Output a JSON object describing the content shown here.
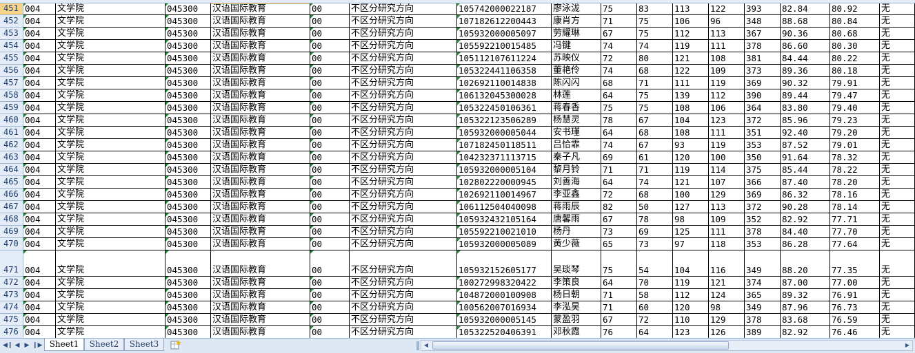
{
  "sheet": {
    "rows": [
      {
        "num": "451",
        "dept_code": "004",
        "dept": "文学院",
        "major_code": "045300",
        "major": "汉语国际教育",
        "dir_code": "00",
        "dir": "不区分研究方向",
        "exam_no": "105742000022187",
        "name": "廖泳泷",
        "s1": "75",
        "s2": "83",
        "s3": "113",
        "s4": "122",
        "total": "393",
        "retest": "82.84",
        "final": "80.92",
        "remark": "无"
      },
      {
        "num": "452",
        "dept_code": "004",
        "dept": "文学院",
        "major_code": "045300",
        "major": "汉语国际教育",
        "dir_code": "00",
        "dir": "不区分研究方向",
        "exam_no": "107182612200443",
        "name": "康肖方",
        "s1": "71",
        "s2": "75",
        "s3": "106",
        "s4": "96",
        "total": "348",
        "retest": "88.68",
        "final": "80.84",
        "remark": "无"
      },
      {
        "num": "453",
        "dept_code": "004",
        "dept": "文学院",
        "major_code": "045300",
        "major": "汉语国际教育",
        "dir_code": "00",
        "dir": "不区分研究方向",
        "exam_no": "105932000005097",
        "name": "劳耀琳",
        "s1": "67",
        "s2": "75",
        "s3": "112",
        "s4": "113",
        "total": "367",
        "retest": "90.36",
        "final": "80.68",
        "remark": "无"
      },
      {
        "num": "454",
        "dept_code": "004",
        "dept": "文学院",
        "major_code": "045300",
        "major": "汉语国际教育",
        "dir_code": "00",
        "dir": "不区分研究方向",
        "exam_no": "105592210015485",
        "name": "冯键",
        "s1": "74",
        "s2": "74",
        "s3": "119",
        "s4": "111",
        "total": "378",
        "retest": "86.60",
        "final": "80.30",
        "remark": "无"
      },
      {
        "num": "455",
        "dept_code": "004",
        "dept": "文学院",
        "major_code": "045300",
        "major": "汉语国际教育",
        "dir_code": "00",
        "dir": "不区分研究方向",
        "exam_no": "105112107611224",
        "name": "苏映仪",
        "s1": "72",
        "s2": "80",
        "s3": "121",
        "s4": "108",
        "total": "381",
        "retest": "84.44",
        "final": "80.22",
        "remark": "无"
      },
      {
        "num": "456",
        "dept_code": "004",
        "dept": "文学院",
        "major_code": "045300",
        "major": "汉语国际教育",
        "dir_code": "00",
        "dir": "不区分研究方向",
        "exam_no": "105322441106358",
        "name": "董艳伶",
        "s1": "74",
        "s2": "68",
        "s3": "122",
        "s4": "109",
        "total": "373",
        "retest": "89.36",
        "final": "80.18",
        "remark": "无"
      },
      {
        "num": "457",
        "dept_code": "004",
        "dept": "文学院",
        "major_code": "045300",
        "major": "汉语国际教育",
        "dir_code": "00",
        "dir": "不区分研究方向",
        "exam_no": "102692110014838",
        "name": "陈闪闪",
        "s1": "68",
        "s2": "71",
        "s3": "111",
        "s4": "119",
        "total": "369",
        "retest": "90.32",
        "final": "79.91",
        "remark": "无"
      },
      {
        "num": "458",
        "dept_code": "004",
        "dept": "文学院",
        "major_code": "045300",
        "major": "汉语国际教育",
        "dir_code": "00",
        "dir": "不区分研究方向",
        "exam_no": "106132045300028",
        "name": "林莲",
        "s1": "64",
        "s2": "75",
        "s3": "139",
        "s4": "112",
        "total": "390",
        "retest": "89.44",
        "final": "79.47",
        "remark": "无"
      },
      {
        "num": "459",
        "dept_code": "004",
        "dept": "文学院",
        "major_code": "045300",
        "major": "汉语国际教育",
        "dir_code": "00",
        "dir": "不区分研究方向",
        "exam_no": "105322450106361",
        "name": "蒋春香",
        "s1": "75",
        "s2": "75",
        "s3": "108",
        "s4": "106",
        "total": "364",
        "retest": "83.80",
        "final": "79.40",
        "remark": "无"
      },
      {
        "num": "460",
        "dept_code": "004",
        "dept": "文学院",
        "major_code": "045300",
        "major": "汉语国际教育",
        "dir_code": "00",
        "dir": "不区分研究方向",
        "exam_no": "105322123506289",
        "name": "杨慧灵",
        "s1": "78",
        "s2": "67",
        "s3": "104",
        "s4": "123",
        "total": "372",
        "retest": "85.96",
        "final": "79.23",
        "remark": "无"
      },
      {
        "num": "461",
        "dept_code": "004",
        "dept": "文学院",
        "major_code": "045300",
        "major": "汉语国际教育",
        "dir_code": "00",
        "dir": "不区分研究方向",
        "exam_no": "105932000005044",
        "name": "安书瑾",
        "s1": "64",
        "s2": "68",
        "s3": "108",
        "s4": "111",
        "total": "351",
        "retest": "92.40",
        "final": "79.20",
        "remark": "无"
      },
      {
        "num": "462",
        "dept_code": "004",
        "dept": "文学院",
        "major_code": "045300",
        "major": "汉语国际教育",
        "dir_code": "00",
        "dir": "不区分研究方向",
        "exam_no": "107182450118511",
        "name": "吕恰霏",
        "s1": "74",
        "s2": "67",
        "s3": "93",
        "s4": "119",
        "total": "353",
        "retest": "87.52",
        "final": "79.01",
        "remark": "无"
      },
      {
        "num": "463",
        "dept_code": "004",
        "dept": "文学院",
        "major_code": "045300",
        "major": "汉语国际教育",
        "dir_code": "00",
        "dir": "不区分研究方向",
        "exam_no": "104232371113715",
        "name": "秦子凡",
        "s1": "69",
        "s2": "61",
        "s3": "120",
        "s4": "100",
        "total": "350",
        "retest": "91.64",
        "final": "78.32",
        "remark": "无"
      },
      {
        "num": "464",
        "dept_code": "004",
        "dept": "文学院",
        "major_code": "045300",
        "major": "汉语国际教育",
        "dir_code": "00",
        "dir": "不区分研究方向",
        "exam_no": "105932000005104",
        "name": "黎月铃",
        "s1": "71",
        "s2": "71",
        "s3": "119",
        "s4": "114",
        "total": "375",
        "retest": "85.44",
        "final": "78.22",
        "remark": "无"
      },
      {
        "num": "465",
        "dept_code": "004",
        "dept": "文学院",
        "major_code": "045300",
        "major": "汉语国际教育",
        "dir_code": "00",
        "dir": "不区分研究方向",
        "exam_no": "102802220000945",
        "name": "刘善海",
        "s1": "64",
        "s2": "74",
        "s3": "121",
        "s4": "107",
        "total": "366",
        "retest": "87.40",
        "final": "78.20",
        "remark": "无"
      },
      {
        "num": "466",
        "dept_code": "004",
        "dept": "文学院",
        "major_code": "045300",
        "major": "汉语国际教育",
        "dir_code": "00",
        "dir": "不区分研究方向",
        "exam_no": "102692110014967",
        "name": "李亚鑫",
        "s1": "72",
        "s2": "68",
        "s3": "100",
        "s4": "129",
        "total": "369",
        "retest": "86.32",
        "final": "78.16",
        "remark": "无"
      },
      {
        "num": "467",
        "dept_code": "004",
        "dept": "文学院",
        "major_code": "045300",
        "major": "汉语国际教育",
        "dir_code": "00",
        "dir": "不区分研究方向",
        "exam_no": "106112504040098",
        "name": "蒋雨辰",
        "s1": "82",
        "s2": "50",
        "s3": "127",
        "s4": "113",
        "total": "372",
        "retest": "90.28",
        "final": "78.14",
        "remark": "无"
      },
      {
        "num": "468",
        "dept_code": "004",
        "dept": "文学院",
        "major_code": "045300",
        "major": "汉语国际教育",
        "dir_code": "00",
        "dir": "不区分研究方向",
        "exam_no": "105932432105164",
        "name": "唐馨雨",
        "s1": "67",
        "s2": "78",
        "s3": "98",
        "s4": "109",
        "total": "352",
        "retest": "82.92",
        "final": "77.71",
        "remark": "无"
      },
      {
        "num": "469",
        "dept_code": "004",
        "dept": "文学院",
        "major_code": "045300",
        "major": "汉语国际教育",
        "dir_code": "00",
        "dir": "不区分研究方向",
        "exam_no": "105592210021010",
        "name": "杨丹",
        "s1": "73",
        "s2": "69",
        "s3": "125",
        "s4": "111",
        "total": "378",
        "retest": "84.40",
        "final": "77.70",
        "remark": "无"
      },
      {
        "num": "470",
        "dept_code": "004",
        "dept": "文学院",
        "major_code": "045300",
        "major": "汉语国际教育",
        "dir_code": "00",
        "dir": "不区分研究方向",
        "exam_no": "105932000005089",
        "name": "黄少薇",
        "s1": "65",
        "s2": "73",
        "s3": "97",
        "s4": "118",
        "total": "353",
        "retest": "86.28",
        "final": "77.64",
        "remark": "无"
      },
      {
        "num": "471",
        "dept_code": "004",
        "dept": "文学院",
        "major_code": "045300",
        "major": "汉语国际教育",
        "dir_code": "00",
        "dir": "不区分研究方向",
        "exam_no": "105932152605177",
        "name": "吴琰琴",
        "s1": "75",
        "s2": "54",
        "s3": "104",
        "s4": "116",
        "total": "349",
        "retest": "88.20",
        "final": "77.35",
        "remark": "无"
      },
      {
        "num": "472",
        "dept_code": "004",
        "dept": "文学院",
        "major_code": "045300",
        "major": "汉语国际教育",
        "dir_code": "00",
        "dir": "不区分研究方向",
        "exam_no": "100272998320422",
        "name": "李策良",
        "s1": "64",
        "s2": "70",
        "s3": "119",
        "s4": "121",
        "total": "374",
        "retest": "87.00",
        "final": "77.00",
        "remark": "无"
      },
      {
        "num": "473",
        "dept_code": "004",
        "dept": "文学院",
        "major_code": "045300",
        "major": "汉语国际教育",
        "dir_code": "00",
        "dir": "不区分研究方向",
        "exam_no": "104872000100908",
        "name": "杨日朝",
        "s1": "71",
        "s2": "58",
        "s3": "112",
        "s4": "124",
        "total": "365",
        "retest": "89.32",
        "final": "76.91",
        "remark": "无"
      },
      {
        "num": "474",
        "dept_code": "004",
        "dept": "文学院",
        "major_code": "045300",
        "major": "汉语国际教育",
        "dir_code": "00",
        "dir": "不区分研究方向",
        "exam_no": "100562007016934",
        "name": "李泓昊",
        "s1": "71",
        "s2": "60",
        "s3": "120",
        "s4": "98",
        "total": "349",
        "retest": "87.96",
        "final": "76.73",
        "remark": "无"
      },
      {
        "num": "475",
        "dept_code": "004",
        "dept": "文学院",
        "major_code": "045300",
        "major": "汉语国际教育",
        "dir_code": "00",
        "dir": "不区分研究方向",
        "exam_no": "105932000005145",
        "name": "蒙盈羽",
        "s1": "67",
        "s2": "72",
        "s3": "110",
        "s4": "129",
        "total": "378",
        "retest": "83.68",
        "final": "76.59",
        "remark": "无"
      },
      {
        "num": "476",
        "dept_code": "004",
        "dept": "文学院",
        "major_code": "045300",
        "major": "汉语国际教育",
        "dir_code": "00",
        "dir": "不区分研究方向",
        "exam_no": "105322520406391",
        "name": "邓秋霞",
        "s1": "76",
        "s2": "64",
        "s3": "123",
        "s4": "126",
        "total": "389",
        "retest": "82.92",
        "final": "76.46",
        "remark": "无"
      }
    ]
  },
  "tabs": {
    "sheets": [
      "Sheet1",
      "Sheet2",
      "Sheet3"
    ],
    "active_index": 0
  },
  "icons": {
    "nav_first": "first-sheet-icon",
    "nav_prev": "prev-sheet-icon",
    "nav_next": "next-sheet-icon",
    "nav_last": "last-sheet-icon",
    "new_sheet": "insert-sheet-icon"
  },
  "colors": {
    "row_header_bg": "#e4ecf7",
    "selected_header_bg": "#f8d38a",
    "grid_line": "#000000",
    "error_triangle": "#1f8a3a",
    "tab_bar_bg": "#dee8f4"
  }
}
